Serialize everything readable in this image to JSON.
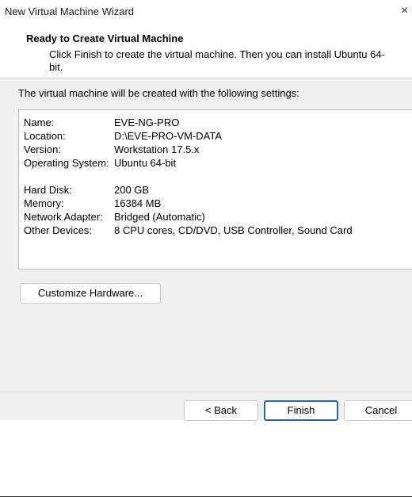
{
  "window": {
    "title": "New Virtual Machine Wizard",
    "close_glyph": "×"
  },
  "header": {
    "title": "Ready to Create Virtual Machine",
    "description": "Click Finish to create the virtual machine. Then you can install Ubuntu 64-bit."
  },
  "intro": "The virtual machine will be created with the following settings:",
  "settings": [
    {
      "label": "Name:",
      "value": "EVE-NG-PRO"
    },
    {
      "label": "Location:",
      "value": "D:\\EVE-PRO-VM-DATA"
    },
    {
      "label": "Version:",
      "value": "Workstation 17.5.x"
    },
    {
      "label": "Operating System:",
      "value": "Ubuntu 64-bit"
    },
    {
      "label": "Hard Disk:",
      "value": "200 GB"
    },
    {
      "label": "Memory:",
      "value": "16384 MB"
    },
    {
      "label": "Network Adapter:",
      "value": "Bridged (Automatic)"
    },
    {
      "label": "Other Devices:",
      "value": "8 CPU cores, CD/DVD, USB Controller, Sound Card"
    }
  ],
  "buttons": {
    "customize": "Customize Hardware...",
    "back": "< Back",
    "finish": "Finish",
    "cancel": "Cancel"
  },
  "colors": {
    "default_button_border": "#2a62c4",
    "dialog_background": "#f0f0f0"
  }
}
